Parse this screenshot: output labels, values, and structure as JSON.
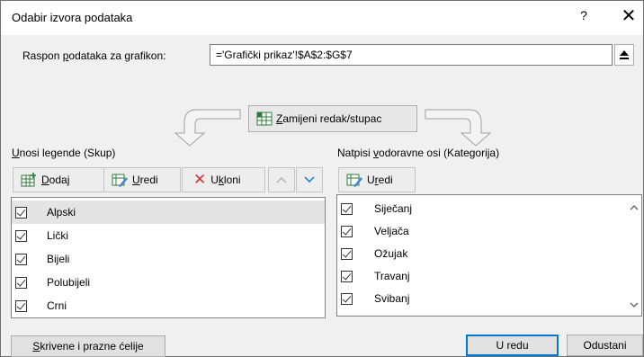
{
  "dialog": {
    "title": "Odabir izvora podataka",
    "help": "?",
    "close": "✕"
  },
  "range": {
    "label_pre": "Raspon ",
    "label_u": "p",
    "label_post": "odataka za grafikon:",
    "value": "='Grafički prikaz'!$A$2:$G$7"
  },
  "switch": {
    "label_u": "Z",
    "label_rest": "amijeni redak/stupac"
  },
  "legend": {
    "label_u": "U",
    "label_rest": "nosi legende (Skup)",
    "add": {
      "u": "D",
      "rest": "odaj"
    },
    "edit": {
      "u": "U",
      "rest": "redi"
    },
    "remove": {
      "pre": "U",
      "u": "k",
      "rest": "loni"
    },
    "items": [
      "Alpski",
      "Lički",
      "Bijeli",
      "Polubijeli",
      "Crni"
    ]
  },
  "axis": {
    "label_pre": "Natpisi ",
    "label_u": "v",
    "label_rest": "odoravne osi (Kategorija)",
    "edit": {
      "u": "r",
      "pre": "U",
      "rest": "edi"
    },
    "items": [
      "Siječanj",
      "Veljača",
      "Ožujak",
      "Travanj",
      "Svibanj"
    ]
  },
  "footer": {
    "hidden": {
      "u": "S",
      "rest": "krivene i prazne ćelije"
    },
    "ok": "U redu",
    "cancel": "Odustani"
  },
  "colors": {
    "accent": "#0078d7",
    "remove_x": "#d13438"
  }
}
